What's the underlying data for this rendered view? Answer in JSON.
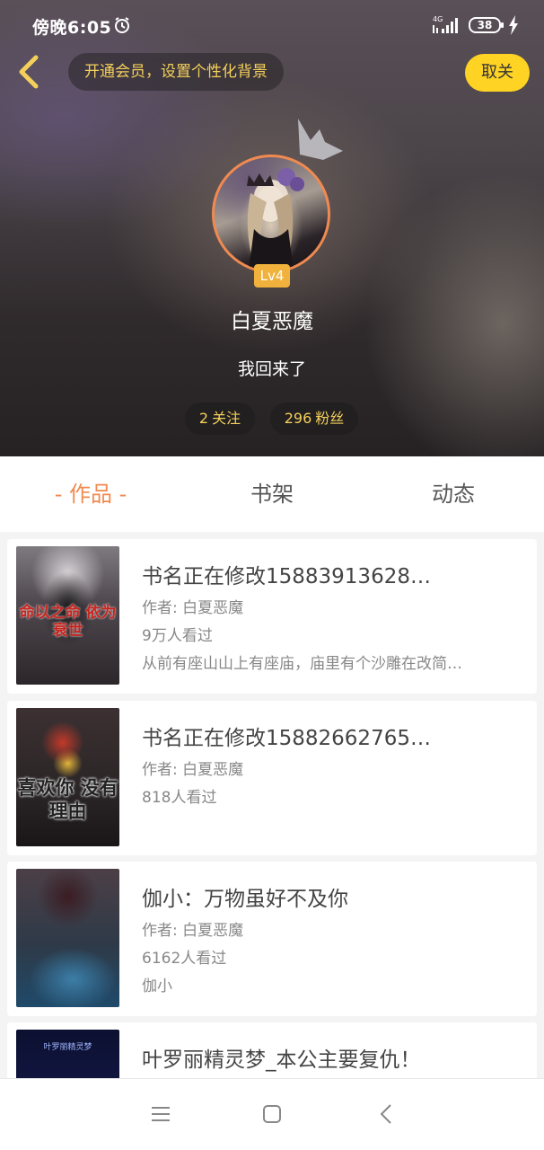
{
  "status_bar": {
    "time": "傍晚6:05",
    "network": "4G",
    "battery": "38"
  },
  "header": {
    "vip_prompt": "开通会员，设置个性化背景",
    "cancel_follow_label": "取关",
    "level": "Lv4",
    "username": "白夏恶魔",
    "signature": "我回来了",
    "following_count": "2",
    "following_label": "关注",
    "fans_count": "296",
    "fans_label": "粉丝"
  },
  "tabs": [
    {
      "label": "- 作品 -",
      "active": true
    },
    {
      "label": "书架",
      "active": false
    },
    {
      "label": "动态",
      "active": false
    }
  ],
  "books": [
    {
      "title": "书名正在修改15883913628…",
      "author": "作者: 白夏恶魔",
      "views": "9万人看过",
      "desc": "从前有座山山上有座庙，庙里有个沙雕在改简…",
      "cover_text": "命以之命 依为衰世"
    },
    {
      "title": "书名正在修改15882662765…",
      "author": "作者: 白夏恶魔",
      "views": "818人看过",
      "desc": "",
      "cover_text": "喜欢你 没有理由"
    },
    {
      "title": "伽小：万物虽好不及你",
      "author": "作者: 白夏恶魔",
      "views": "6162人看过",
      "desc": "伽小",
      "cover_text": ""
    },
    {
      "title": "叶罗丽精灵梦_本公主要复仇！",
      "author": "",
      "views": "",
      "desc": "",
      "cover_text": "叶罗丽精灵梦"
    }
  ],
  "colors": {
    "accent": "#f08a50",
    "gold": "#f4d05a",
    "button_yellow": "#ffd324"
  },
  "icons": [
    "back-icon",
    "alarm-icon",
    "signal-icon",
    "battery-icon",
    "crown-icon",
    "menu-icon",
    "home-icon",
    "nav-back-icon"
  ]
}
